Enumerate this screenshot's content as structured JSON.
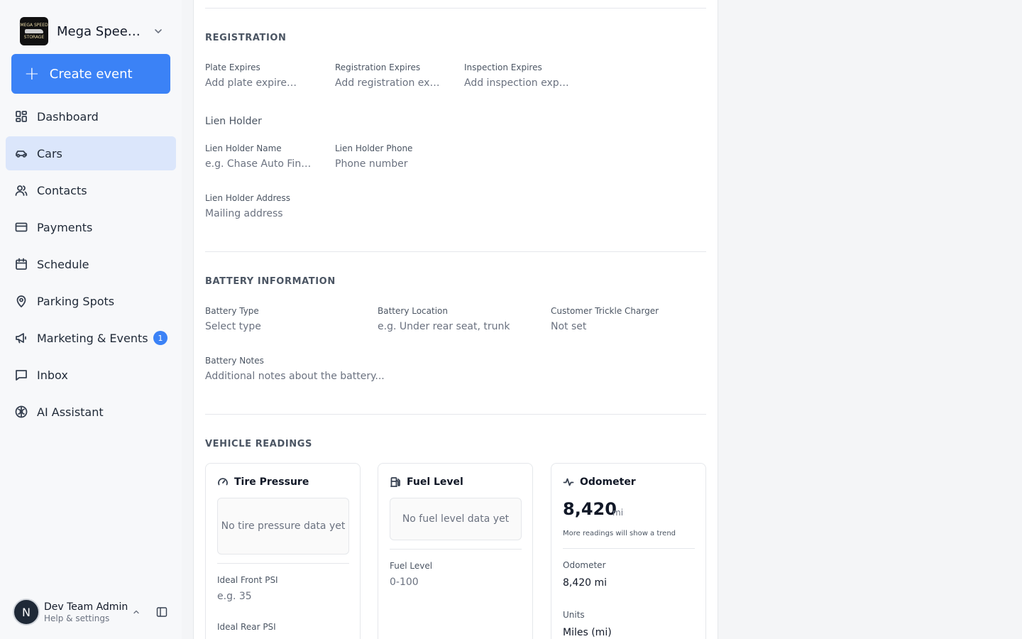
{
  "org": {
    "name": "Mega Speed Storage",
    "logo_text": "MEGA SPEED",
    "logo_sub": "STORAGE"
  },
  "create_event": {
    "label": "Create event"
  },
  "nav": {
    "items": [
      {
        "label": "Dashboard",
        "icon": "dashboard-icon"
      },
      {
        "label": "Cars",
        "icon": "car-icon",
        "active": true
      },
      {
        "label": "Contacts",
        "icon": "users-icon"
      },
      {
        "label": "Payments",
        "icon": "credit-card-icon"
      },
      {
        "label": "Schedule",
        "icon": "calendar-icon"
      },
      {
        "label": "Parking Spots",
        "icon": "map-pin-icon"
      },
      {
        "label": "Marketing & Events",
        "icon": "megaphone-icon",
        "badge": "1"
      },
      {
        "label": "Inbox",
        "icon": "message-icon"
      },
      {
        "label": "AI Assistant",
        "icon": "brain-icon"
      }
    ]
  },
  "user": {
    "initial": "N",
    "name": "Dev Team Admin",
    "subtitle": "Help & settings"
  },
  "registration": {
    "title": "REGISTRATION",
    "plate_expires": {
      "label": "Plate Expires",
      "placeholder": "Add plate expires..."
    },
    "registration_expires": {
      "label": "Registration Expires",
      "placeholder": "Add registration expires..."
    },
    "inspection_expires": {
      "label": "Inspection Expires",
      "placeholder": "Add inspection expires..."
    },
    "lien_holder_heading": "Lien Holder",
    "lien_holder_name": {
      "label": "Lien Holder Name",
      "placeholder": "e.g. Chase Auto Finance"
    },
    "lien_holder_phone": {
      "label": "Lien Holder Phone",
      "placeholder": "Phone number"
    },
    "lien_holder_address": {
      "label": "Lien Holder Address",
      "placeholder": "Mailing address"
    }
  },
  "battery": {
    "title": "BATTERY INFORMATION",
    "type": {
      "label": "Battery Type",
      "value": "Select type"
    },
    "location": {
      "label": "Battery Location",
      "placeholder": "e.g. Under rear seat, trunk"
    },
    "trickle": {
      "label": "Customer Trickle Charger",
      "value": "Not set"
    },
    "notes": {
      "label": "Battery Notes",
      "placeholder": "Additional notes about the battery..."
    }
  },
  "readings": {
    "title": "VEHICLE READINGS",
    "tire": {
      "title": "Tire Pressure",
      "empty": "No tire pressure data yet",
      "front_label": "Ideal Front PSI",
      "front_placeholder": "e.g. 35",
      "rear_label": "Ideal Rear PSI"
    },
    "fuel": {
      "title": "Fuel Level",
      "empty": "No fuel level data yet",
      "level_label": "Fuel Level",
      "level_placeholder": "0-100"
    },
    "odometer": {
      "title": "Odometer",
      "big_value": "8,420",
      "big_unit": "mi",
      "note": "More readings will show a trend",
      "odo_label": "Odometer",
      "odo_value": "8,420 mi",
      "units_label": "Units",
      "units_value": "Miles (mi)"
    }
  }
}
